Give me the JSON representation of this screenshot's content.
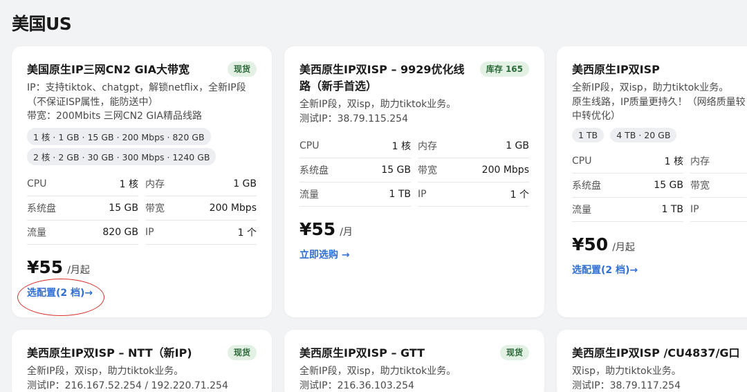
{
  "page": {
    "title": "美国US"
  },
  "cards": [
    {
      "title": "美国原生IP三网CN2 GIA大带宽",
      "badge": "现货",
      "desc": [
        "IP：支持tiktok、chatgpt，解锁netflix，全新IP段",
        "（不保证ISP属性，能防送中）",
        "带宽：200Mbits 三网CN2 GIA精品线路"
      ],
      "chips": [
        "1 核 · 1 GB · 15 GB · 200 Mbps · 820 GB",
        "2 核 · 2 GB · 30 GB · 300 Mbps · 1240 GB"
      ],
      "specs": [
        {
          "label": "CPU",
          "value": "1 核"
        },
        {
          "label": "内存",
          "value": "1 GB"
        },
        {
          "label": "系统盘",
          "value": "15 GB"
        },
        {
          "label": "带宽",
          "value": "200 Mbps"
        },
        {
          "label": "流量",
          "value": "820 GB"
        },
        {
          "label": "IP",
          "value": "1 个"
        }
      ],
      "price": "¥55",
      "price_unit": "/月起",
      "cta": "选配置(2 档)→"
    },
    {
      "title": "美西原生IP双ISP – 9929优化线路（新手首选）",
      "badge": "库存 165",
      "desc": [
        "全新IP段，双isp，助力tiktok业务。",
        "测试IP：38.79.115.254"
      ],
      "chips": [],
      "specs": [
        {
          "label": "CPU",
          "value": "1 核"
        },
        {
          "label": "内存",
          "value": "1 GB"
        },
        {
          "label": "系统盘",
          "value": "15 GB"
        },
        {
          "label": "带宽",
          "value": "200 Mbps"
        },
        {
          "label": "流量",
          "value": "1 TB"
        },
        {
          "label": "IP",
          "value": "1 个"
        }
      ],
      "price": "¥55",
      "price_unit": "/月",
      "cta": "立即选购 →"
    },
    {
      "title": "美西原生IP双ISP",
      "badge": "",
      "desc": [
        "全新IP段，双isp，助力tiktok业务。",
        "原生线路，IP质量更持久！（网络质量较",
        "中转优化）"
      ],
      "chips": [
        "1 TB",
        "4 TB · 20 GB"
      ],
      "specs": [
        {
          "label": "CPU",
          "value": "1 核"
        },
        {
          "label": "内存",
          "value": ""
        },
        {
          "label": "系统盘",
          "value": "15 GB"
        },
        {
          "label": "带宽",
          "value": ""
        },
        {
          "label": "流量",
          "value": "1 TB"
        },
        {
          "label": "IP",
          "value": ""
        }
      ],
      "price": "¥50",
      "price_unit": "/月起",
      "cta": "选配置(2 档)→"
    },
    {
      "title": "美西原生IP双ISP – NTT（新IP)",
      "badge": "现货",
      "desc": [
        "全新IP段，双isp，助力tiktok业务。",
        "测试IP：216.167.52.254 / 192.220.71.254"
      ]
    },
    {
      "title": "美西原生IP双ISP – GTT",
      "badge": "现货",
      "desc": [
        "全新IP段，双isp，助力tiktok业务。",
        "测试IP：216.36.103.254"
      ]
    },
    {
      "title": "美西原生IP双ISP /CU4837/G口",
      "badge": "",
      "desc": [
        "双isp，助力tiktok业务。",
        "测试IP：38.79.117.254"
      ]
    }
  ]
}
